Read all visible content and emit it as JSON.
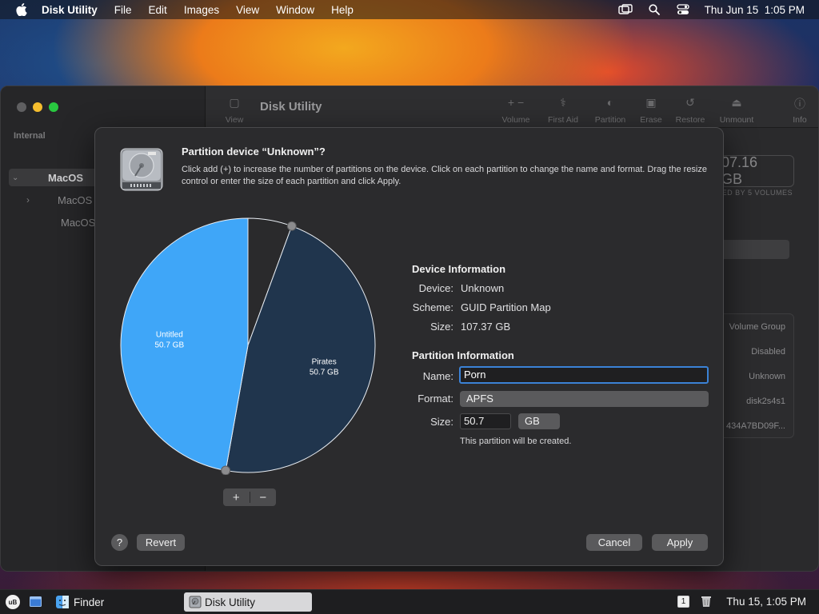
{
  "menubar": {
    "app_name": "Disk Utility",
    "items": [
      "File",
      "Edit",
      "Images",
      "View",
      "Window",
      "Help"
    ],
    "clock": "Thu Jun 15  1:05 PM"
  },
  "du_window": {
    "title": "Disk Utility",
    "sidebar": {
      "section": "Internal",
      "items": [
        {
          "label": "MacOS"
        },
        {
          "label": "MacOS"
        },
        {
          "label": "MacOS"
        }
      ]
    },
    "toolbar": {
      "view_label": "View",
      "volume_label": "Volume",
      "first_aid_label": "First Aid",
      "partition_label": "Partition",
      "erase_label": "Erase",
      "restore_label": "Restore",
      "unmount_label": "Unmount",
      "info_label": "Info"
    },
    "capacity": "07.16 GB",
    "shared_note": "ED BY 5 VOLUMES",
    "info_rows": [
      "Volume Group",
      "Disabled",
      "Unknown",
      "disk2s4s1",
      "434A7BD09F..."
    ]
  },
  "sheet": {
    "title": "Partition device “Unknown”?",
    "description": "Click add (+) to increase the number of partitions on the device. Click on each partition to change the name and format. Drag the resize control or enter the size of each partition and click Apply.",
    "pie": {
      "slices": [
        {
          "name": "Untitled",
          "size": "50.7 GB",
          "fraction": 0.472,
          "color": "#3fa6f8"
        },
        {
          "name": "Pirates",
          "size": "50.7 GB",
          "fraction": 0.472,
          "color": "#20354d"
        },
        {
          "name": "",
          "size": "",
          "fraction": 0.056,
          "color": "#2a2a2c"
        }
      ]
    },
    "add_label": "+",
    "remove_label": "−",
    "device_info": {
      "heading": "Device Information",
      "device_label": "Device:",
      "device_value": "Unknown",
      "scheme_label": "Scheme:",
      "scheme_value": "GUID Partition Map",
      "size_label": "Size:",
      "size_value": "107.37 GB"
    },
    "partition_info": {
      "heading": "Partition Information",
      "name_label": "Name:",
      "name_value": "Porn",
      "format_label": "Format:",
      "format_value": "APFS",
      "size_label": "Size:",
      "size_value": "50.7",
      "unit_value": "GB",
      "note": "This partition will be created."
    },
    "help_label": "?",
    "revert_label": "Revert",
    "cancel_label": "Cancel",
    "apply_label": "Apply"
  },
  "taskbar": {
    "start_label": "uB",
    "tasks": [
      {
        "label": "Finder"
      },
      {
        "label": "Disk Utility"
      }
    ],
    "notification_count": "1",
    "clock": "Thu 15, 1:05 PM"
  }
}
